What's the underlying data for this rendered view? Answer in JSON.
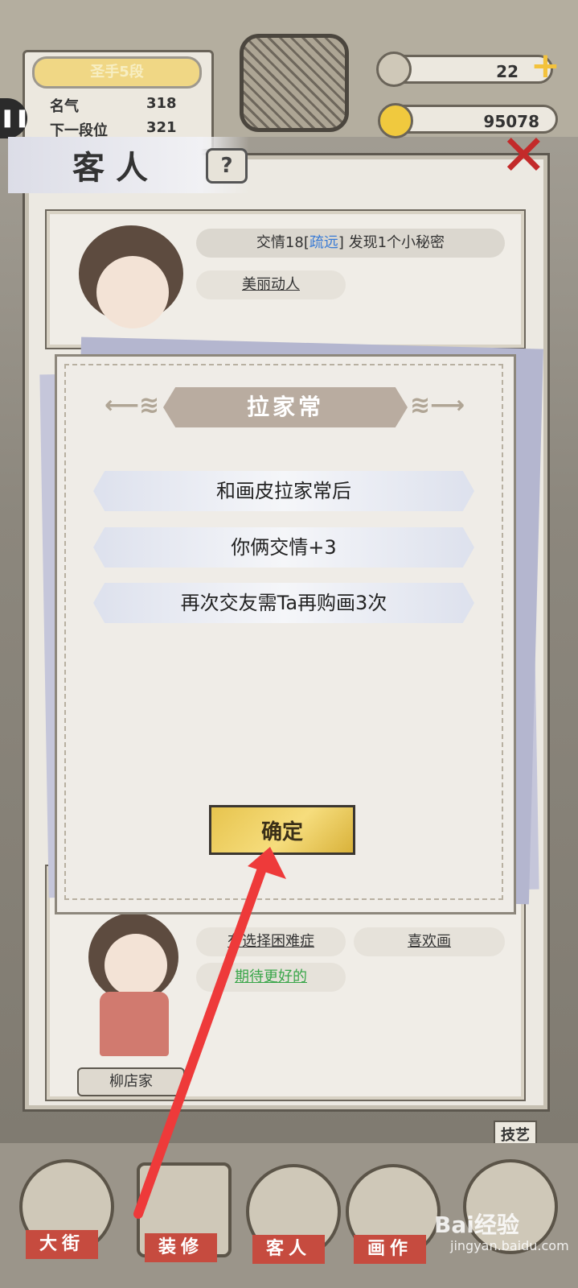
{
  "top": {
    "rank": "圣手5段",
    "fame_label": "名气",
    "fame_value": "318",
    "next_label": "下一段位",
    "next_value": "321",
    "currency_1": "22",
    "currency_2": "95078"
  },
  "guest_panel": {
    "title": "客人",
    "help": "?",
    "card1": {
      "status_prefix": "交情18[",
      "status_link": "疏远",
      "status_suffix": "] 发现1个小秘密",
      "trait": "美丽动人"
    },
    "card2": {
      "trait_1": "有选择困难症",
      "trait_2": "喜欢画",
      "trait_3": "期待更好的",
      "name": "柳店家"
    }
  },
  "dialog": {
    "title": "拉家常",
    "lines": [
      "和画皮拉家常后",
      "你俩交情+3",
      "再次交友需Ta再购画3次"
    ],
    "confirm": "确定"
  },
  "side": {
    "skill": "技艺"
  },
  "nav": {
    "items": [
      "大街",
      "装修",
      "客人",
      "画作"
    ]
  },
  "watermark": {
    "text": "Bai经验",
    "url": "jingyan.baidu.com"
  },
  "colors": {
    "accent_red": "#ee3a3a",
    "confirm_gold": "#f6dd7d",
    "link_blue": "#3a7bd5"
  }
}
